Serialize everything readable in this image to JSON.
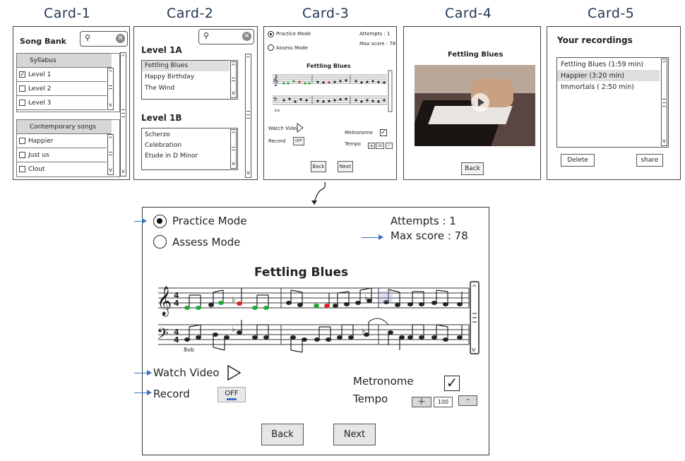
{
  "card_titles": [
    "Card-1",
    "Card-2",
    "Card-3",
    "Card-4",
    "Card-5"
  ],
  "card1": {
    "title": "Song Bank",
    "syllabus_header": "Syllabus",
    "syllabus_items": [
      {
        "label": "Level 1",
        "checked": true
      },
      {
        "label": "Level 2",
        "checked": false
      },
      {
        "label": "Level 3",
        "checked": false
      }
    ],
    "contemporary_header": "Contemporary songs",
    "contemporary_items": [
      {
        "label": "Happier",
        "checked": false
      },
      {
        "label": "Just us",
        "checked": false
      },
      {
        "label": "Clout",
        "checked": false
      }
    ]
  },
  "card2": {
    "level_a": "Level 1A",
    "level_a_items": [
      "Fettling Blues",
      "Happy Birthday",
      "The Wind"
    ],
    "level_b": "Level 1B",
    "level_b_items": [
      "Scherzo",
      "Celebration",
      "Etude in D Minor"
    ]
  },
  "card3": {
    "practice_mode": "Practice Mode",
    "assess_mode": "Assess Mode",
    "attempts": "Attempts : 1",
    "max_score": "Max score : 78",
    "song_title": "Fettling Blues",
    "watch_video": "Watch Video",
    "record": "Record",
    "record_toggle": "OFF",
    "metronome": "Metronome",
    "tempo": "Tempo",
    "tempo_value": "100",
    "plus": "+",
    "minus": "-",
    "back": "Back",
    "next": "Next"
  },
  "card4": {
    "title": "Fettling Blues",
    "back": "Back"
  },
  "card5": {
    "title": "Your recordings",
    "recordings": [
      "Fettling Blues (1:59 min)",
      "Happier (3:20 min)",
      "Immortals ( 2:50 min)"
    ],
    "delete": "Delete",
    "share": "share"
  },
  "detail": {
    "practice_mode": "Practice Mode",
    "assess_mode": "Assess Mode",
    "attempts": "Attempts : 1",
    "max_score": "Max score : 78",
    "song_title": "Fettling Blues",
    "watch_video": "Watch Video",
    "record": "Record",
    "record_toggle": "OFF",
    "metronome": "Metronome",
    "tempo": "Tempo",
    "tempo_value": "100",
    "plus": "+",
    "minus": "-",
    "back": "Back",
    "next": "Next",
    "clef_marking": "8vb"
  },
  "colors": {
    "annotation_arrow": "#3a6fc4",
    "note_green": "#1fa83a",
    "note_red": "#e02020",
    "title_text": "#1f3550"
  }
}
